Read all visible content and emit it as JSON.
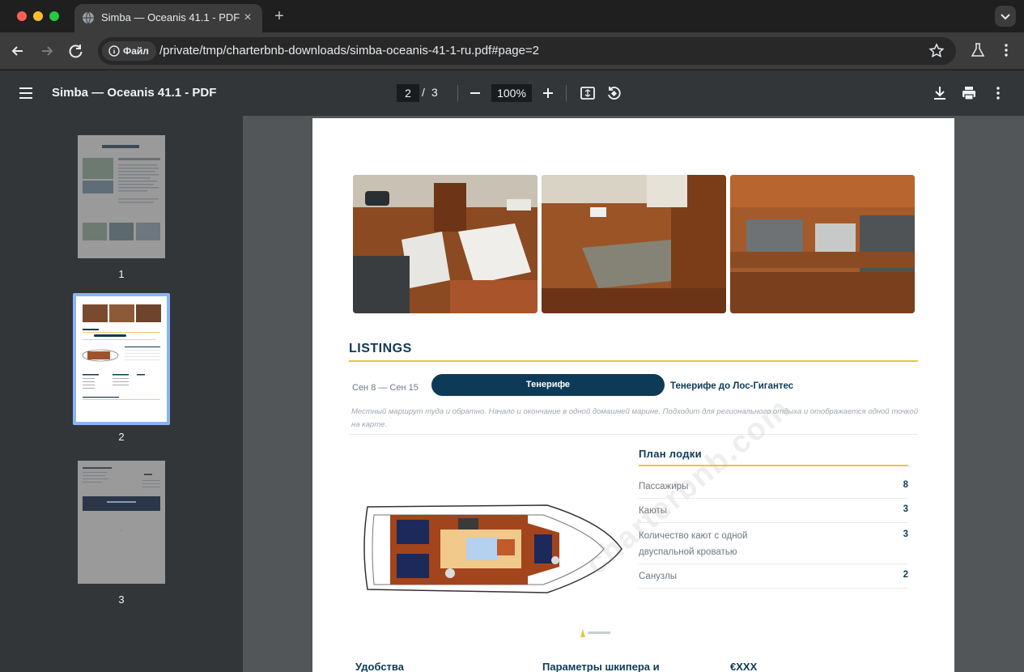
{
  "browser": {
    "tab_title": "Simba — Oceanis 41.1 - PDF",
    "chip_label": "Файл",
    "url": "/private/tmp/charterbnb-downloads/simba-oceanis-41-1-ru.pdf#page=2"
  },
  "pdf_toolbar": {
    "title": "Simba — Oceanis 41.1 - PDF",
    "current_page": "2",
    "separator": "/",
    "total_pages": "3",
    "zoom": "100%"
  },
  "thumbnails": [
    {
      "label": "1"
    },
    {
      "label": "2"
    },
    {
      "label": "3"
    }
  ],
  "page": {
    "listings_heading": "LISTINGS",
    "dates": "Сен 8 — Сен 15",
    "location_pill": "Тенерифе",
    "route": "Тенерифе до Лос-Гигантес",
    "description": "Местный маршрут туда и обратно. Начало и окончание в одной домашней марине. Подходит для регионального отдыха и отображается одной точкой на карте.",
    "plan_heading": "План лодки",
    "plan_rows": [
      {
        "label": "Пассажиры",
        "value": "8"
      },
      {
        "label": "Каюты",
        "value": "3"
      },
      {
        "label": "Количество кают с одной двуспальной кроватью",
        "value": "3"
      },
      {
        "label": "Санузлы",
        "value": "2"
      }
    ],
    "watermark": "charterbnb.com",
    "footer": {
      "col1": "Удобства",
      "col2": "Параметры шкипера и",
      "col3": "€XXX"
    }
  }
}
